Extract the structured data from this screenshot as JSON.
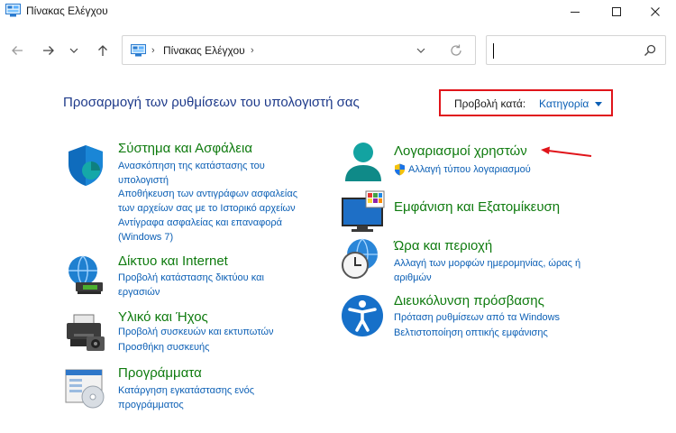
{
  "window": {
    "title": "Πίνακας Ελέγχου",
    "controls": [
      "minimize",
      "maximize",
      "close"
    ]
  },
  "navigation": {
    "back_icon": "arrow-left-icon",
    "forward_icon": "arrow-right-icon",
    "history_icon": "chevron-down-icon",
    "up_icon": "arrow-up-icon",
    "address": {
      "segment": "Πίνακας Ελέγχου",
      "separator": "›"
    },
    "search": {
      "value": "",
      "placeholder": ""
    }
  },
  "main": {
    "heading": "Προσαρμογή των ρυθμίσεων του υπολογιστή σας",
    "view_by": {
      "label": "Προβολή κατά:",
      "value": "Κατηγορία"
    }
  },
  "categories_left": [
    {
      "icon": "shield-icon",
      "title": "Σύστημα και Ασφάλεια",
      "links": [
        [
          "Ανασκόπηση της κατάστασης του",
          "υπολογιστή"
        ],
        [
          "Αποθήκευση των αντιγράφων ασφαλείας",
          "των αρχείων σας με το Ιστορικό αρχείων"
        ],
        [
          "Αντίγραφα ασφαλείας και επαναφορά",
          "(Windows 7)"
        ]
      ]
    },
    {
      "icon": "network-globe-icon",
      "title": "Δίκτυο και Internet",
      "links": [
        [
          "Προβολή κατάστασης δικτύου και",
          "εργασιών"
        ]
      ]
    },
    {
      "icon": "printer-icon",
      "title": "Υλικό και Ήχος",
      "links": [
        [
          "Προβολή συσκευών και εκτυπωτών"
        ],
        [
          "Προσθήκη συσκευής"
        ]
      ]
    },
    {
      "icon": "programs-disc-icon",
      "title": "Προγράμματα",
      "links": [
        [
          "Κατάργηση εγκατάστασης ενός",
          "προγράμματος"
        ]
      ]
    }
  ],
  "categories_right": [
    {
      "icon": "user-accounts-icon",
      "title": "Λογαριασμοί χρηστών",
      "links": [
        [
          "Αλλαγή τύπου λογαριασμού"
        ]
      ]
    },
    {
      "icon": "appearance-monitor-icon",
      "title": "Εμφάνιση και Εξατομίκευση",
      "links": []
    },
    {
      "icon": "clock-globe-icon",
      "title": "Ώρα και περιοχή",
      "links": [
        [
          "Αλλαγή των μορφών ημερομηνίας, ώρας ή",
          "αριθμών"
        ]
      ]
    },
    {
      "icon": "accessibility-icon",
      "title": "Διευκόλυνση πρόσβασης",
      "links": [
        [
          "Πρόταση ρυθμίσεων από τα Windows"
        ],
        [
          "Βελτιστοποίηση οπτικής εμφάνισης"
        ]
      ]
    }
  ],
  "colors": {
    "heading": "#1e3a8a",
    "category_title": "#0f7b0f",
    "link": "#0b5fb5",
    "highlight_box": "#e0141a",
    "annotation_arrow": "#e0141a"
  }
}
